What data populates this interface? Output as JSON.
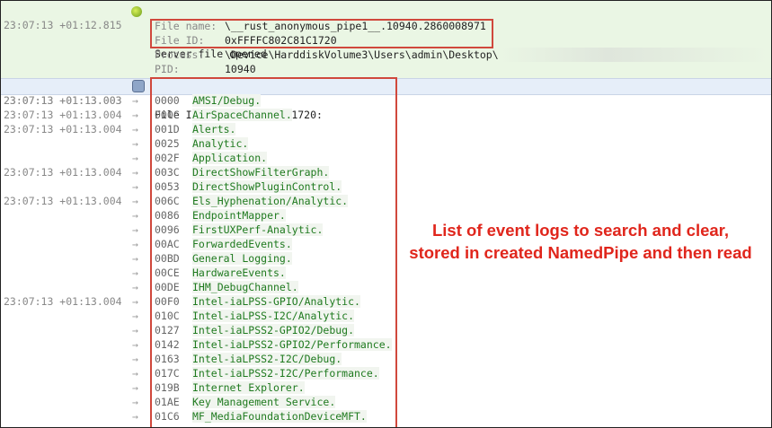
{
  "event": {
    "timestamp": "23:07:13 +01:12.815",
    "title": "Server file opened",
    "icon": "plug-icon",
    "fields": [
      {
        "key": "File name:",
        "value": "\\__rust_anonymous_pipe1__.10940.2860008971"
      },
      {
        "key": "File ID:",
        "value": "0xFFFFC802C81C1720"
      },
      {
        "key": "Process:",
        "value": "\\Device\\HarddiskVolume3\\Users\\admin\\Desktop\\"
      },
      {
        "key": "PID:",
        "value": "10940"
      }
    ]
  },
  "read": {
    "timestamp": "23:07:13 +01:13.003",
    "header": "File ID 0xFFFFC802C81C1720:",
    "icon": "database-icon",
    "rows": [
      {
        "ts": "23:07:13 +01:13.003",
        "code": "0000",
        "name": "AMSI/Debug."
      },
      {
        "ts": "23:07:13 +01:13.004",
        "code": "000C",
        "name": "AirSpaceChannel."
      },
      {
        "ts": "23:07:13 +01:13.004",
        "code": "001D",
        "name": "Alerts."
      },
      {
        "ts": "",
        "code": "0025",
        "name": "Analytic."
      },
      {
        "ts": "",
        "code": "002F",
        "name": "Application."
      },
      {
        "ts": "23:07:13 +01:13.004",
        "code": "003C",
        "name": "DirectShowFilterGraph."
      },
      {
        "ts": "",
        "code": "0053",
        "name": "DirectShowPluginControl."
      },
      {
        "ts": "23:07:13 +01:13.004",
        "code": "006C",
        "name": "Els_Hyphenation/Analytic."
      },
      {
        "ts": "",
        "code": "0086",
        "name": "EndpointMapper."
      },
      {
        "ts": "",
        "code": "0096",
        "name": "FirstUXPerf-Analytic."
      },
      {
        "ts": "",
        "code": "00AC",
        "name": "ForwardedEvents."
      },
      {
        "ts": "",
        "code": "00BD",
        "name": "General Logging."
      },
      {
        "ts": "",
        "code": "00CE",
        "name": "HardwareEvents."
      },
      {
        "ts": "",
        "code": "00DE",
        "name": "IHM_DebugChannel."
      },
      {
        "ts": "23:07:13 +01:13.004",
        "code": "00F0",
        "name": "Intel-iaLPSS-GPIO/Analytic."
      },
      {
        "ts": "",
        "code": "010C",
        "name": "Intel-iaLPSS-I2C/Analytic."
      },
      {
        "ts": "",
        "code": "0127",
        "name": "Intel-iaLPSS2-GPIO2/Debug."
      },
      {
        "ts": "",
        "code": "0142",
        "name": "Intel-iaLPSS2-GPIO2/Performance."
      },
      {
        "ts": "",
        "code": "0163",
        "name": "Intel-iaLPSS2-I2C/Debug."
      },
      {
        "ts": "",
        "code": "017C",
        "name": "Intel-iaLPSS2-I2C/Performance."
      },
      {
        "ts": "",
        "code": "019B",
        "name": "Internet Explorer."
      },
      {
        "ts": "",
        "code": "01AE",
        "name": "Key Management Service."
      },
      {
        "ts": "",
        "code": "01C6",
        "name": "MF_MediaFoundationDeviceMFT."
      }
    ]
  },
  "annotation": {
    "line1": "List of event logs to search and clear,",
    "line2": "stored in created NamedPipe and then read",
    "color": "#e0261c"
  },
  "arrow_glyph": "→"
}
